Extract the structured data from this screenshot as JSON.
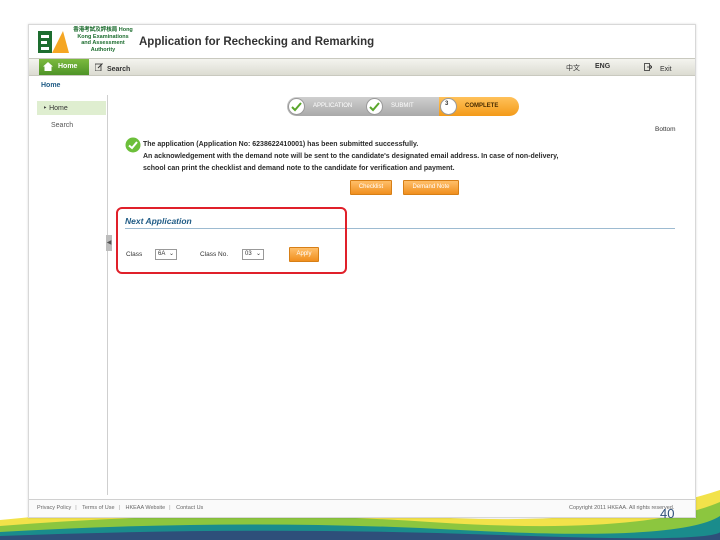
{
  "header": {
    "logo_text": "香港考試及評核局 Hong Kong Examinations and Assessment Authority",
    "app_title": "Application for Rechecking and Remarking"
  },
  "topnav": {
    "home": "Home",
    "search": "Search",
    "lang_zh": "中文",
    "lang_en": "ENG",
    "exit": "Exit"
  },
  "breadcrumb": "Home",
  "sidebar": {
    "items": [
      {
        "label": "Home"
      },
      {
        "label": "Search"
      }
    ]
  },
  "steps": [
    {
      "label": "APPLICATION",
      "state": "done"
    },
    {
      "label": "SUBMIT",
      "state": "done"
    },
    {
      "number": "3",
      "label": "COMPLETE",
      "state": "current"
    }
  ],
  "bottom_link": "Bottom",
  "message": {
    "line1": "The application (Application No: 6238622410001) has been submitted successfully.",
    "line2": "An acknowledgement with the demand note will be sent to the candidate's designated email address. In case of non-delivery,",
    "line3": "school can print the checklist and demand note to the candidate for verification and payment."
  },
  "buttons": {
    "checklist": "Checklist",
    "demand_note": "Demand Note"
  },
  "next_application": {
    "title": "Next Application",
    "class_label": "Class",
    "class_value": "6A",
    "class_no_label": "Class No.",
    "class_no_value": "03",
    "apply": "Apply"
  },
  "footer": {
    "links": [
      "Privacy Policy",
      "Terms of Use",
      "HKEAA Website",
      "Contact Us"
    ],
    "copyright": "Copyright 2011 HKEAA. All rights reserved."
  },
  "page_number": "40",
  "colors": {
    "accent_green": "#4e9327",
    "accent_orange": "#f39a18",
    "highlight_red": "#e0202a",
    "title_blue": "#1f5b85"
  }
}
